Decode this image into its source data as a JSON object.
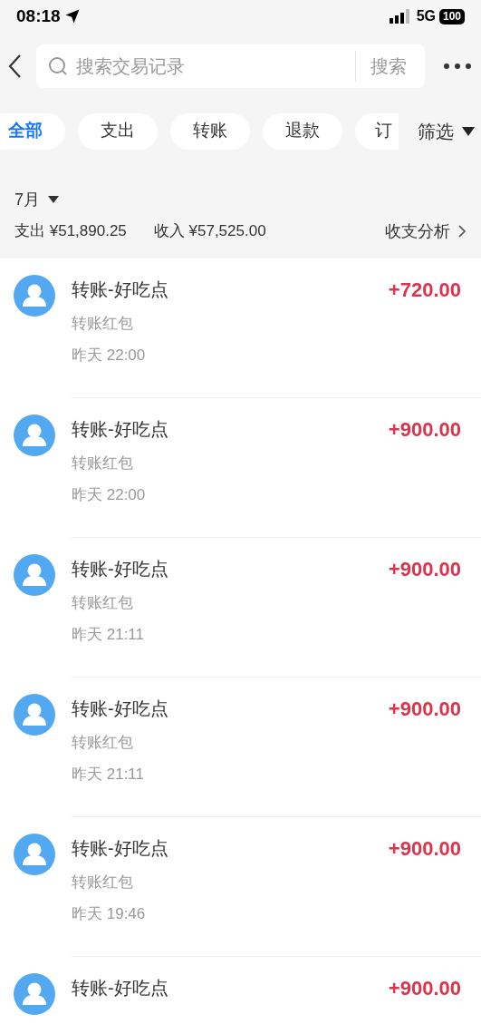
{
  "status_bar": {
    "time": "08:18",
    "network": "5G",
    "battery": "100"
  },
  "search": {
    "placeholder": "搜索交易记录",
    "button": "搜索"
  },
  "filters": [
    {
      "label": "全部",
      "selected": true
    },
    {
      "label": "支出",
      "selected": false
    },
    {
      "label": "转账",
      "selected": false
    },
    {
      "label": "退款",
      "selected": false
    },
    {
      "label": "订",
      "selected": false
    }
  ],
  "filter_button": "筛选",
  "month": "7月",
  "summary": {
    "expense": "支出 ¥51,890.25",
    "income": "收入 ¥57,525.00",
    "analysis": "收支分析"
  },
  "transactions": [
    {
      "title": "转账-好吃点",
      "subtitle": "转账红包",
      "time": "昨天 22:00",
      "amount": "+720.00"
    },
    {
      "title": "转账-好吃点",
      "subtitle": "转账红包",
      "time": "昨天 22:00",
      "amount": "+900.00"
    },
    {
      "title": "转账-好吃点",
      "subtitle": "转账红包",
      "time": "昨天 21:11",
      "amount": "+900.00"
    },
    {
      "title": "转账-好吃点",
      "subtitle": "转账红包",
      "time": "昨天 21:11",
      "amount": "+900.00"
    },
    {
      "title": "转账-好吃点",
      "subtitle": "转账红包",
      "time": "昨天 19:46",
      "amount": "+900.00"
    },
    {
      "title": "转账-好吃点",
      "amount": "+900.00"
    }
  ]
}
